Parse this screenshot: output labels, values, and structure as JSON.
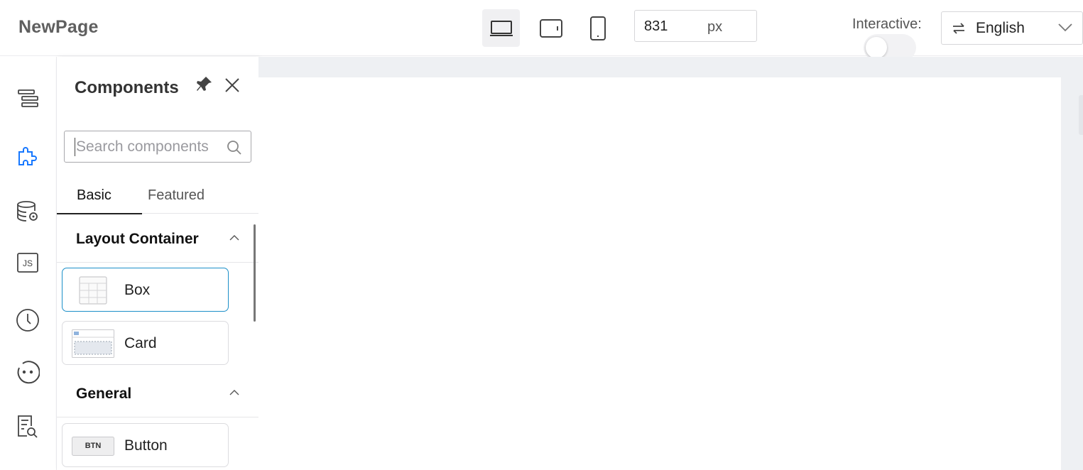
{
  "app": {
    "title": "NewPage"
  },
  "toolbar": {
    "devices": [
      {
        "name": "desktop",
        "icon": "laptop-icon",
        "active": true
      },
      {
        "name": "tablet",
        "icon": "tablet-icon",
        "active": false
      },
      {
        "name": "mobile",
        "icon": "phone-icon",
        "active": false
      }
    ],
    "width_value": "831",
    "width_unit": "px",
    "interactive_label": "Interactive:",
    "interactive_on": false,
    "language": {
      "icon": "swap-icon",
      "selected": "English"
    }
  },
  "rail": {
    "items": [
      {
        "icon": "outline-icon",
        "active": false
      },
      {
        "icon": "components-puzzle-icon",
        "active": true
      },
      {
        "icon": "data-source-icon",
        "active": false
      },
      {
        "icon": "js-icon",
        "active": false
      },
      {
        "icon": "history-clock-icon",
        "active": false
      },
      {
        "icon": "assistant-face-icon",
        "active": false
      },
      {
        "icon": "page-search-icon",
        "active": false
      }
    ],
    "accent": "#1677ff"
  },
  "panel": {
    "title": "Components",
    "search": {
      "placeholder": "Search components",
      "value": ""
    },
    "tabs": [
      {
        "label": "Basic",
        "active": true
      },
      {
        "label": "Featured",
        "active": false
      }
    ],
    "sections": [
      {
        "label": "Layout Container",
        "expanded": true,
        "items": [
          {
            "label": "Box",
            "icon": "box-grid-icon",
            "selected": true
          },
          {
            "label": "Card",
            "icon": "card-icon",
            "selected": false
          }
        ]
      },
      {
        "label": "General",
        "expanded": true,
        "items": [
          {
            "label": "Button",
            "icon": "btn-icon",
            "thumb_text": "BTN",
            "selected": false
          }
        ]
      }
    ]
  }
}
